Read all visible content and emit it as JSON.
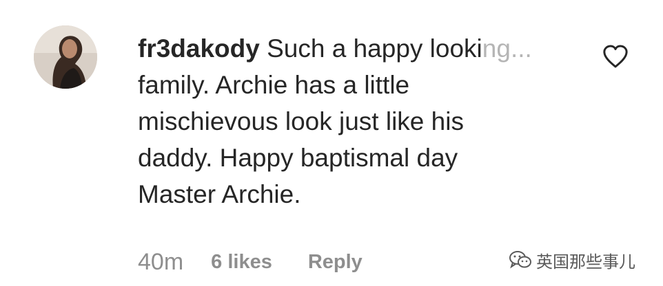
{
  "comment": {
    "username": "fr3dakody",
    "text_first_line": "Such a happy looki",
    "text_truncated_tail": "ng...",
    "text_lines": [
      "family. Archie has a little",
      "mischievous look just like his",
      "daddy. Happy baptismal day",
      "Master Archie."
    ],
    "timestamp": "40m",
    "likes_label": "6 likes",
    "reply_label": "Reply",
    "like_icon": "heart-outline-icon",
    "avatar_icon": "user-avatar"
  },
  "watermark": {
    "text": "英国那些事儿",
    "icon": "wechat-icon"
  },
  "colors": {
    "text": "#262626",
    "secondary": "#8e8e8e"
  }
}
